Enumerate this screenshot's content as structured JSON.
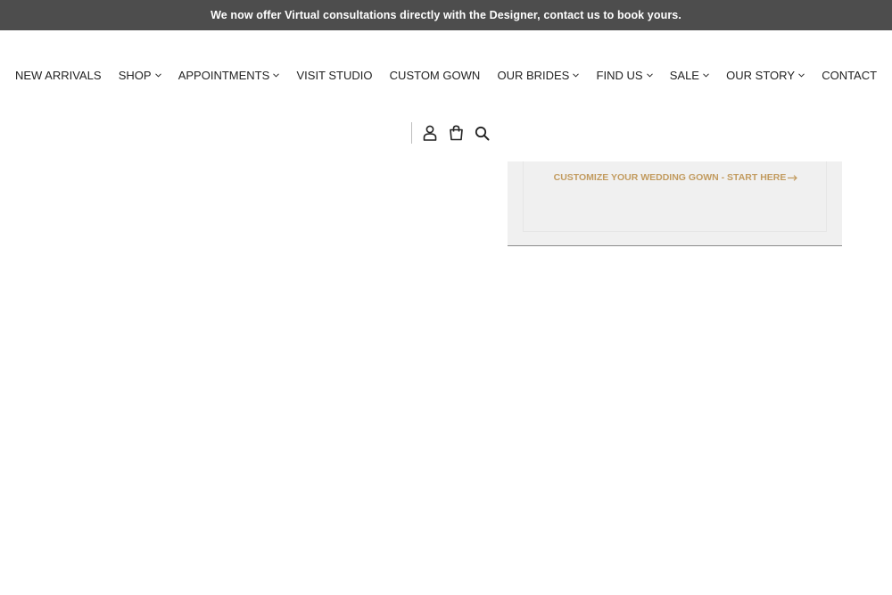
{
  "announcement": {
    "text": "We now offer Virtual consultations directly with the Designer, contact us to book yours."
  },
  "nav": {
    "items": [
      {
        "label": "NEW ARRIVALS",
        "dropdown": false
      },
      {
        "label": "SHOP",
        "dropdown": true
      },
      {
        "label": "APPOINTMENTS",
        "dropdown": true
      },
      {
        "label": "VISIT STUDIO",
        "dropdown": false
      },
      {
        "label": "CUSTOM GOWN",
        "dropdown": false
      },
      {
        "label": "OUR BRIDES",
        "dropdown": true
      },
      {
        "label": "FIND US",
        "dropdown": true
      },
      {
        "label": "SALE",
        "dropdown": true
      },
      {
        "label": "OUR STORY",
        "dropdown": true
      },
      {
        "label": "CONTACT",
        "dropdown": false
      }
    ]
  },
  "header_icons": [
    "user-icon",
    "cart-icon",
    "search-icon"
  ],
  "custom_panel": {
    "link_text": "CUSTOMIZE YOUR WEDDING GOWN - START HERE",
    "link_color": "#c29b5f"
  },
  "colors": {
    "announcement_bg": "#4d4d4d",
    "text": "#222222",
    "panel_bg": "#f0f0f0"
  }
}
